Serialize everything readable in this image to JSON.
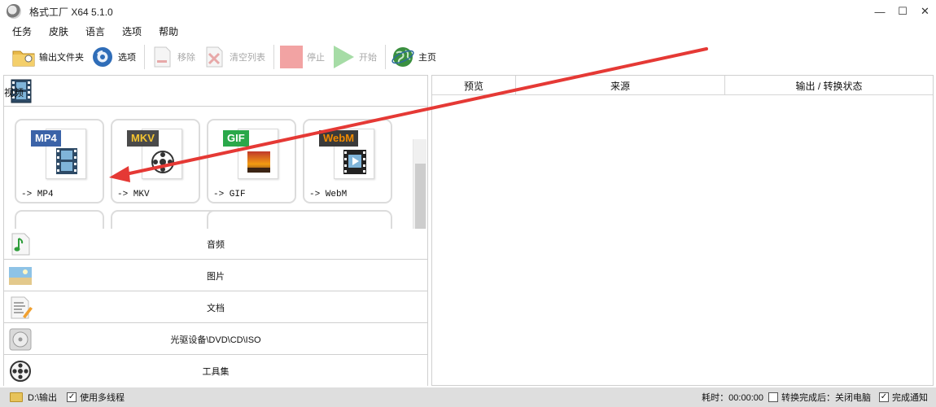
{
  "window": {
    "title": "格式工厂 X64 5.1.0",
    "minimize": "—",
    "maximize": "☐",
    "close": "✕"
  },
  "menu": [
    "任务",
    "皮肤",
    "语言",
    "选项",
    "帮助"
  ],
  "toolbar": {
    "output_folder": "输出文件夹",
    "options": "选项",
    "remove": "移除",
    "clear_list": "清空列表",
    "stop": "停止",
    "start": "开始",
    "home": "主页"
  },
  "categories": {
    "video": "视频",
    "audio": "音频",
    "image": "图片",
    "document": "文档",
    "disc": "光驱设备\\DVD\\CD\\ISO",
    "tools": "工具集"
  },
  "formats": [
    {
      "tag": "MP4",
      "label": "-> MP4",
      "color": "#3b63a8"
    },
    {
      "tag": "MKV",
      "label": "-> MKV",
      "color": "#4a4a4a",
      "tag_text_color": "#f4c430"
    },
    {
      "tag": "GIF",
      "label": "-> GIF",
      "color": "#2aa84a"
    },
    {
      "tag": "WebM",
      "label": "-> WebM",
      "color": "#3a3a3a",
      "tag_text_color": "#f08a00"
    }
  ],
  "table": {
    "columns": [
      "预览",
      "来源",
      "输出 / 转换状态"
    ]
  },
  "status": {
    "output_path": "D:\\输出",
    "multithread": "使用多线程",
    "elapsed": "耗时：00:00:00",
    "after_done": "转换完成后：关闭电脑",
    "notify": "完成通知"
  },
  "colors": {
    "arrow": "#e53935",
    "statusbar": "#dedede",
    "stop_disabled": "#f2a3a3",
    "start_disabled": "#a6dca6"
  },
  "icons": {
    "app": "format-factory-logo-icon",
    "output_folder": "folder-icon",
    "options": "gear-icon",
    "remove": "remove-document-icon",
    "clear_list": "clear-list-icon",
    "stop": "stop-icon",
    "start": "play-icon",
    "home": "globe-icon"
  }
}
